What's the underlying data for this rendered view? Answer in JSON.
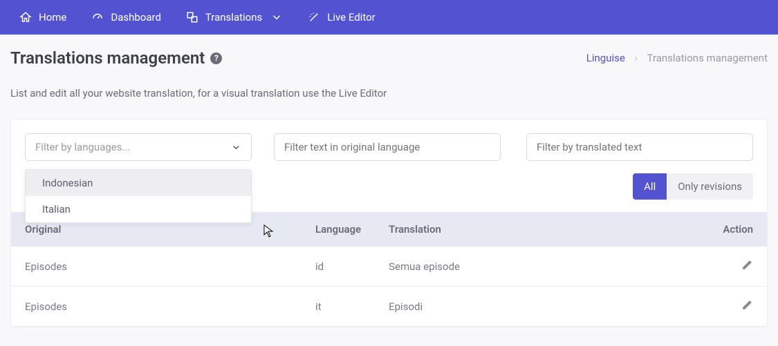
{
  "nav": {
    "home": "Home",
    "dashboard": "Dashboard",
    "translations": "Translations",
    "live_editor": "Live Editor"
  },
  "page": {
    "title": "Translations management",
    "subtitle": "List and edit all your website translation, for a visual translation use the Live Editor"
  },
  "breadcrumb": {
    "root": "Linguise",
    "current": "Translations management"
  },
  "filters": {
    "lang_placeholder": "Filter by languages...",
    "original_placeholder": "Filter text in original language",
    "translated_placeholder": "Filter by translated text",
    "dropdown": [
      "Indonesian",
      "Italian"
    ]
  },
  "toggles": {
    "all": "All",
    "revisions": "Only revisions"
  },
  "table": {
    "headers": {
      "original": "Original",
      "language": "Language",
      "translation": "Translation",
      "action": "Action"
    },
    "rows": [
      {
        "original": "Episodes",
        "lang": "id",
        "translation": "Semua episode"
      },
      {
        "original": "Episodes",
        "lang": "it",
        "translation": "Episodi"
      }
    ]
  }
}
